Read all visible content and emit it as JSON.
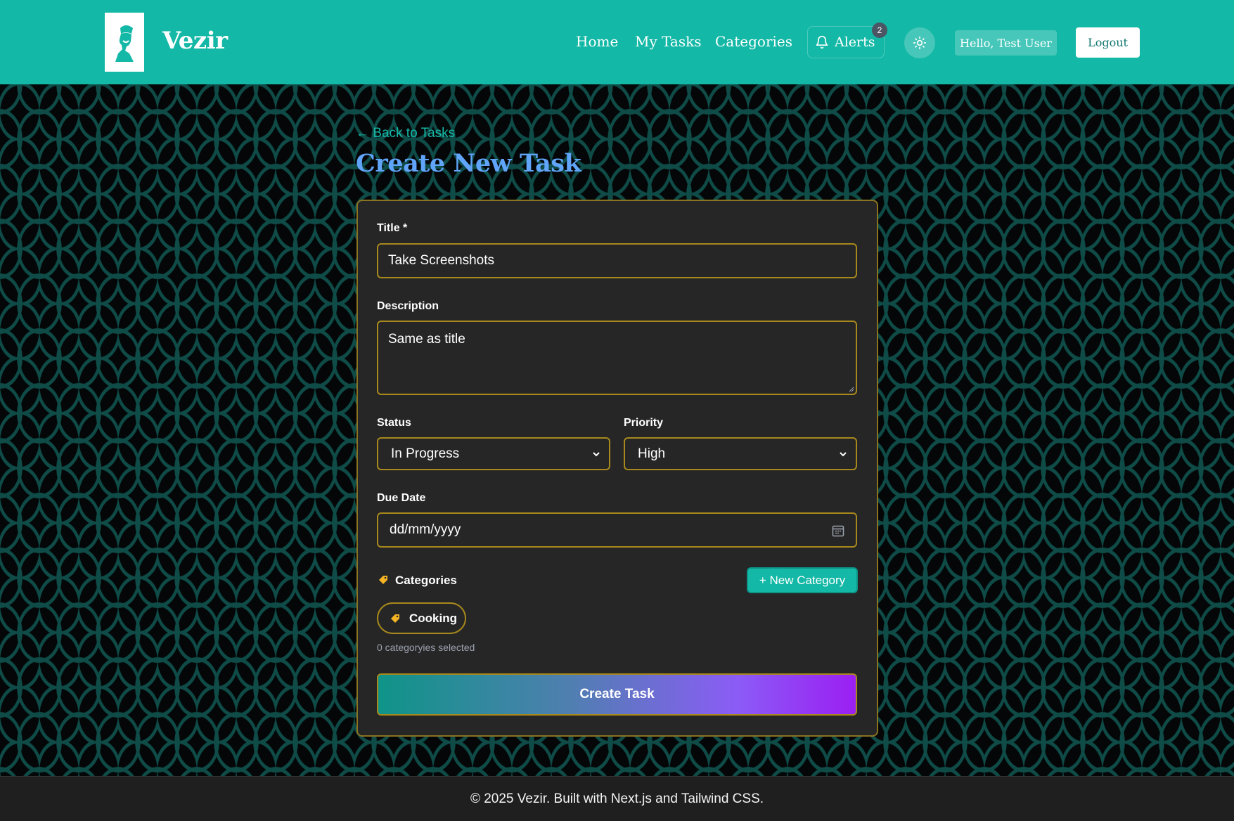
{
  "brand": {
    "name": "Vezir"
  },
  "nav": {
    "home": "Home",
    "tasks": "My Tasks",
    "categories": "Categories",
    "alerts": "Alerts",
    "alerts_count": "2",
    "greeting": "Hello, Test User",
    "logout": "Logout"
  },
  "page": {
    "back_link": "← Back to Tasks",
    "title": "Create New Task"
  },
  "form": {
    "title_label": "Title *",
    "title_value": "Take Screenshots",
    "description_label": "Description",
    "description_value": "Same as title",
    "status_label": "Status",
    "status_value": "In Progress",
    "priority_label": "Priority",
    "priority_value": "High",
    "due_label": "Due Date",
    "due_placeholder": "dd/mm/yyyy",
    "categories_label": "Categories",
    "new_category_button": "+ New Category",
    "category_chip": "Cooking",
    "categories_hint": "0 categoryies selected",
    "submit": "Create Task"
  },
  "footer": {
    "text": "© 2025 Vezir. Built with Next.js and Tailwind CSS."
  },
  "colors": {
    "header": "#14b8a6",
    "accent_title": "#60a5fa",
    "field_border": "#a8891d",
    "card_bg": "#262626"
  },
  "icons": {
    "logo": "vizier-portrait-icon",
    "alerts": "bell-icon",
    "theme": "sun-icon",
    "calendar": "calendar-icon",
    "tag": "tag-icon",
    "caret": "chevron-down-icon"
  }
}
